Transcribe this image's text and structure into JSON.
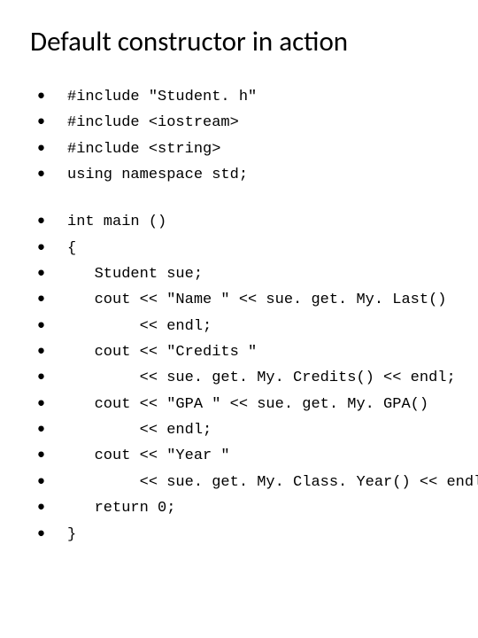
{
  "title": "Default constructor in action",
  "block1": [
    "#include \"Student. h\"",
    "#include <iostream>",
    "#include <string>",
    "using namespace std;"
  ],
  "block2": [
    "int main ()",
    "{",
    "   Student sue;",
    "   cout << \"Name \" << sue. get. My. Last()",
    "        << endl;",
    "   cout << \"Credits \"",
    "        << sue. get. My. Credits() << endl;",
    "   cout << \"GPA \" << sue. get. My. GPA()",
    "        << endl;",
    "   cout << \"Year \"",
    "        << sue. get. My. Class. Year() << endl;",
    "   return 0;",
    "}"
  ]
}
